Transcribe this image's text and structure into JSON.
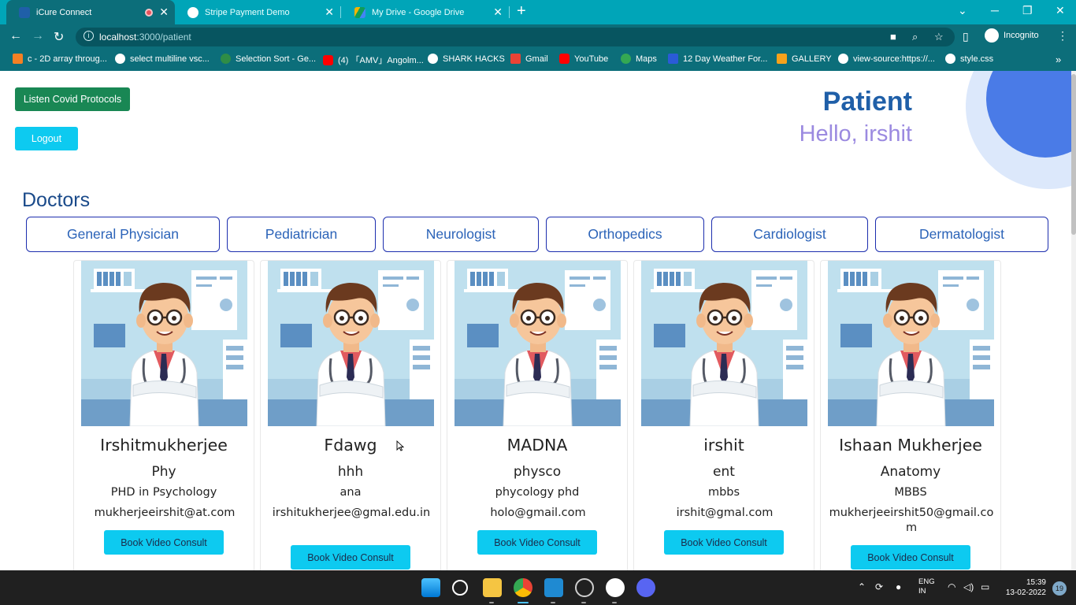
{
  "browser": {
    "tabs": [
      {
        "title": "iCure Connect",
        "active": true
      },
      {
        "title": "Stripe Payment Demo",
        "active": false
      },
      {
        "title": "My Drive - Google Drive",
        "active": false
      }
    ],
    "address": {
      "host": "localhost",
      "path": ":3000/patient"
    },
    "profile_label": "Incognito",
    "bookmarks": [
      "c - 2D array throug...",
      "select multiline vsc...",
      "Selection Sort - Ge...",
      "(4) 「AMV」Angolm...",
      "SHARK HACKS",
      "Gmail",
      "YouTube",
      "Maps",
      "12 Day Weather For...",
      "GALLERY",
      "view-source:https://...",
      "style.css"
    ]
  },
  "page": {
    "covid_button": "Listen Covid Protocols",
    "logout_button": "Logout",
    "title": "Patient",
    "greeting": "Hello, irshit",
    "section_title": "Doctors",
    "specialties": [
      "General Physician",
      "Pediatrician",
      "Neurologist",
      "Orthopedics",
      "Cardiologist",
      "Dermatologist"
    ],
    "doctors": [
      {
        "name": "Irshitmukherjee",
        "specialty": "Phy",
        "degree": "PHD in Psychology",
        "email": "mukherjeeirshit@at.com",
        "action": "Book Video Consult"
      },
      {
        "name": "Fdawg",
        "specialty": "hhh",
        "degree": "ana",
        "email": "irshitukherjee@gmal.edu.in",
        "action": "Book Video Consult"
      },
      {
        "name": "MADNA",
        "specialty": "physco",
        "degree": "phycology phd",
        "email": "holo@gmail.com",
        "action": "Book Video Consult"
      },
      {
        "name": "irshit",
        "specialty": "ent",
        "degree": "mbbs",
        "email": "irshit@gmal.com",
        "action": "Book Video Consult"
      },
      {
        "name": "Ishaan Mukherjee",
        "specialty": "Anatomy",
        "degree": "MBBS",
        "email": "mukherjeeirshit50@gmail.com",
        "action": "Book Video Consult"
      }
    ]
  },
  "taskbar": {
    "language": "ENG",
    "region": "IN",
    "time": "15:39",
    "date": "13-02-2022",
    "notifications": "19"
  },
  "colors": {
    "tab_bar": "#00a5b8",
    "toolbar": "#0c6e7a",
    "success_button": "#198754",
    "info_button": "#0dcaf0",
    "title_blue": "#1f5fa8",
    "greeting_purple": "#9b8ae0",
    "specialty_border": "#1c2eae"
  }
}
